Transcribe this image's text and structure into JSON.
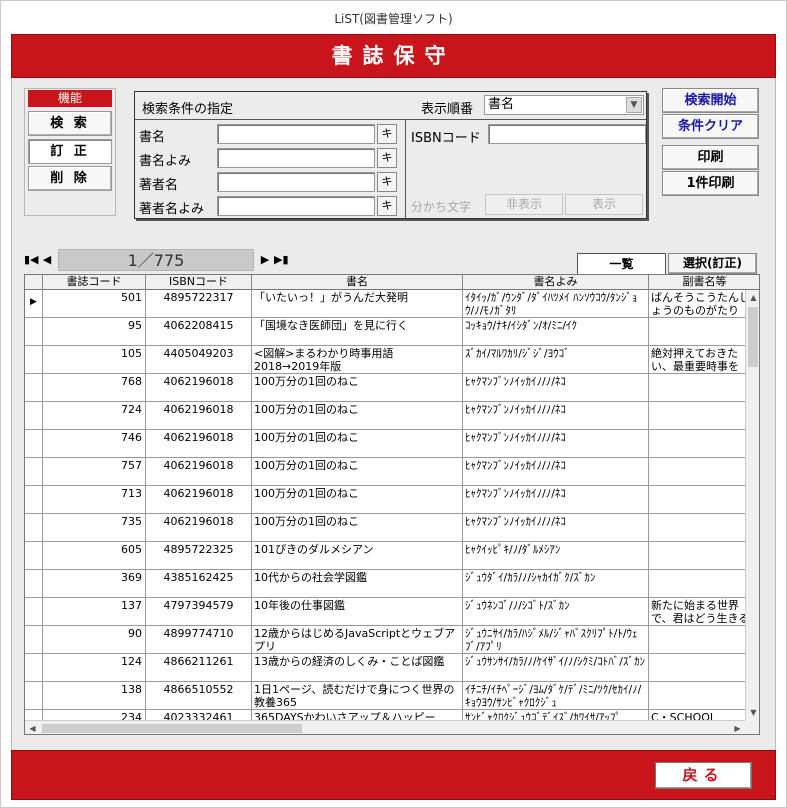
{
  "window": {
    "title": "LiST(図書管理ソフト)"
  },
  "banner": {
    "title": "書誌保守"
  },
  "functions": {
    "header": "機能",
    "search": "検 索",
    "edit": "訂 正",
    "delete": "削 除"
  },
  "search_panel": {
    "title": "検索条件の指定",
    "order_label": "表示順番",
    "order_value": "書名",
    "fields": [
      {
        "label": "書名",
        "value": ""
      },
      {
        "label": "書名よみ",
        "value": ""
      },
      {
        "label": "著者名",
        "value": ""
      },
      {
        "label": "著者名よみ",
        "value": ""
      }
    ],
    "kana_button": "キ",
    "isbn_label": "ISBNコード",
    "isbn_value": "",
    "separator_label": "分かち文字",
    "hide_button": "非表示",
    "show_button": "表示"
  },
  "actions": {
    "start_search": "検索開始",
    "clear_conditions": "条件クリア",
    "print": "印刷",
    "print_one": "1件印刷"
  },
  "navigation": {
    "first": "▮◀",
    "prev": "◀",
    "display": "1／775",
    "next": "▶",
    "last": "▶▮"
  },
  "tabs": {
    "list": "一覧",
    "select": "選択(訂正)"
  },
  "table": {
    "columns": [
      "書誌コード",
      "ISBNコード",
      "書名",
      "書名よみ",
      "副書名等"
    ],
    "rows": [
      {
        "selected": true,
        "code": "501",
        "isbn": "4895722317",
        "title": "「いたいっ！」がうんだ大発明",
        "reading": "ｲﾀｲｯ/ｶﾞ/ｳﾝﾀﾞ/ﾀﾞｲﾊﾂﾒｲ ﾊﾝｿｳｺｳ/ﾀﾝｼﾞｮｳ/ﾉ/ﾓﾉｶﾞﾀﾘ",
        "subtitle": "ばんそうこうたんじょうのものがたり"
      },
      {
        "selected": false,
        "code": "95",
        "isbn": "4062208415",
        "title": "「国境なき医師団」を見に行く",
        "reading": "ｺｯｷｮｳ/ﾅｷ/ｲｼﾀﾞﾝ/ｵ/ﾐﾆ/ｲｸ",
        "subtitle": ""
      },
      {
        "selected": false,
        "code": "105",
        "isbn": "4405049203",
        "title": "<図解>まるわかり時事用語　2018→2019年版",
        "reading": "ｽﾞｶｲ/ﾏﾙﾜｶﾘ/ｼﾞｼﾞ/ﾖｳｺﾞ",
        "subtitle": "絶対押えておきたい、最重要時事を"
      },
      {
        "selected": false,
        "code": "768",
        "isbn": "4062196018",
        "title": "100万分の1回のねこ",
        "reading": "ﾋｬｸﾏﾝﾌﾞﾝﾉｲｯｶｲﾉ/ﾉ/ﾈｺ",
        "subtitle": ""
      },
      {
        "selected": false,
        "code": "724",
        "isbn": "4062196018",
        "title": "100万分の1回のねこ",
        "reading": "ﾋｬｸﾏﾝﾌﾞﾝﾉｲｯｶｲﾉ/ﾉ/ﾈｺ",
        "subtitle": ""
      },
      {
        "selected": false,
        "code": "746",
        "isbn": "4062196018",
        "title": "100万分の1回のねこ",
        "reading": "ﾋｬｸﾏﾝﾌﾞﾝﾉｲｯｶｲﾉ/ﾉ/ﾈｺ",
        "subtitle": ""
      },
      {
        "selected": false,
        "code": "757",
        "isbn": "4062196018",
        "title": "100万分の1回のねこ",
        "reading": "ﾋｬｸﾏﾝﾌﾞﾝﾉｲｯｶｲﾉ/ﾉ/ﾈｺ",
        "subtitle": ""
      },
      {
        "selected": false,
        "code": "713",
        "isbn": "4062196018",
        "title": "100万分の1回のねこ",
        "reading": "ﾋｬｸﾏﾝﾌﾞﾝﾉｲｯｶｲﾉ/ﾉ/ﾈｺ",
        "subtitle": ""
      },
      {
        "selected": false,
        "code": "735",
        "isbn": "4062196018",
        "title": "100万分の1回のねこ",
        "reading": "ﾋｬｸﾏﾝﾌﾞﾝﾉｲｯｶｲﾉ/ﾉ/ﾈｺ",
        "subtitle": ""
      },
      {
        "selected": false,
        "code": "605",
        "isbn": "4895722325",
        "title": "101ぴきのダルメシアン",
        "reading": "ﾋｬｸｲｯﾋﾟｷ/ﾉ/ﾀﾞﾙﾒｼｱﾝ",
        "subtitle": ""
      },
      {
        "selected": false,
        "code": "369",
        "isbn": "4385162425",
        "title": "10代からの社会学図鑑",
        "reading": "ｼﾞｭｳﾀﾞｲ/ｶﾗ/ﾉ/ｼｬｶｲｶﾞｸ/ｽﾞｶﾝ",
        "subtitle": ""
      },
      {
        "selected": false,
        "code": "137",
        "isbn": "4797394579",
        "title": "10年後の仕事図鑑",
        "reading": "ｼﾞｭｳﾈﾝｺﾞ/ﾉ/ｼｺﾞﾄ/ｽﾞｶﾝ",
        "subtitle": "新たに始まる世界で、君はどう生きるか"
      },
      {
        "selected": false,
        "code": "90",
        "isbn": "4899774710",
        "title": "12歳からはじめるJavaScriptとウェブアプリ",
        "reading": "ｼﾞｭｳﾆｻｲ/ｶﾗ/ﾊｼﾞﾒﾙ/ｼﾞｬﾊﾞｽｸﾘﾌﾟﾄ/ﾄ/ｳｪﾌﾞ/ｱﾌﾟﾘ",
        "subtitle": ""
      },
      {
        "selected": false,
        "code": "124",
        "isbn": "4866211261",
        "title": "13歳からの経済のしくみ・ことば図鑑",
        "reading": "ｼﾞｭｳｻﾝｻｲ/ｶﾗ/ﾉ/ｹｲｻﾞｲ/ﾉ/ｼｸﾐ/ｺﾄﾊﾞ/ｽﾞｶﾝ",
        "subtitle": ""
      },
      {
        "selected": false,
        "code": "138",
        "isbn": "4866510552",
        "title": "1日1ページ、読むだけで身につく世界の教養365",
        "reading": "ｲﾁﾆﾁ/ｲﾁﾍﾟｰｼﾞ/ﾖﾑ/ﾀﾞｹ/ﾃﾞ/ﾐﾆ/ﾂｸ/ｾｶｲ/ﾉ/ｷｮｳﾖｳ/ｻﾝﾋﾞｬｸﾛｸｼﾞｭ",
        "subtitle": ""
      },
      {
        "selected": false,
        "code": "234",
        "isbn": "4023332461",
        "title": "365DAYSかわいさアップ＆ハッピー",
        "reading": "ｻﾝﾋﾞｬｸﾛｸｼﾞｭｳｺﾞﾃﾞｲｽﾞ/ｶﾜｲｻ/ｱｯﾌﾟ",
        "subtitle": "C・SCHOOL"
      }
    ]
  },
  "footer": {
    "back": "戻る"
  },
  "colors": {
    "accent": "#c8141a",
    "link_blue": "#1a1aa8",
    "panel_bg": "#ebebeb"
  }
}
